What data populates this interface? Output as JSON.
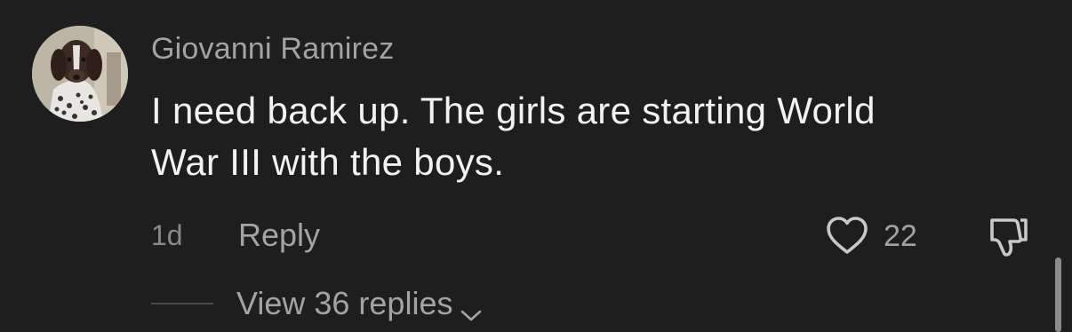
{
  "comment": {
    "username": "Giovanni Ramirez",
    "text_line1": "I need back up. The girls are starting World",
    "text_line2": "War III with the boys.",
    "timestamp": "1d",
    "reply_label": "Reply",
    "like_count": "22",
    "view_replies_label": "View 36 replies",
    "icons": {
      "avatar": "dog-avatar",
      "like": "heart-icon",
      "dislike": "thumbs-down-icon",
      "expand": "chevron-down-icon"
    }
  },
  "colors": {
    "background": "#1e1e1e",
    "username": "#a3a3a3",
    "body_text": "#f2f2f2",
    "muted": "#8a8a8a"
  }
}
